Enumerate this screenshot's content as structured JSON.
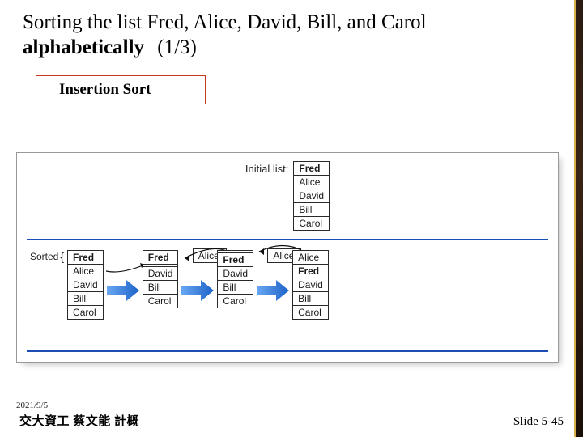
{
  "title": {
    "line": "Sorting the list Fred, Alice, David, Bill, and Carol",
    "emph": "alphabetically",
    "part": "(1/3)"
  },
  "subtitle": "Insertion Sort",
  "diagram": {
    "initial_label": "Initial list:",
    "initial_stack": [
      "Fred",
      "Alice",
      "David",
      "Bill",
      "Carol"
    ],
    "sorted_label": "Sorted",
    "steps": [
      {
        "stack": [
          "Fred",
          "Alice",
          "David",
          "Bill",
          "Carol"
        ],
        "bold_index": 0,
        "float": null
      },
      {
        "stack": [
          "Fred",
          "",
          "David",
          "Bill",
          "Carol"
        ],
        "bold_index": 0,
        "float": "Alice"
      },
      {
        "stack": [
          "",
          "Fred",
          "David",
          "Bill",
          "Carol"
        ],
        "bold_index": 1,
        "float": "Alice"
      },
      {
        "stack": [
          "Alice",
          "Fred",
          "David",
          "Bill",
          "Carol"
        ],
        "bold_index": 1,
        "float": null
      }
    ]
  },
  "footer": {
    "date": "2021/9/5",
    "credit": "交大資工 蔡文能 計概",
    "slideno": "Slide 5-45"
  }
}
